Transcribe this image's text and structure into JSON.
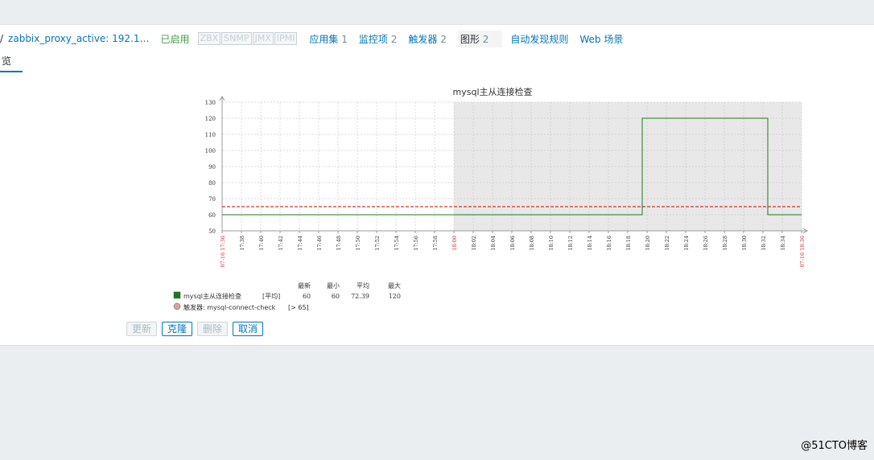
{
  "nav": {
    "sep": "/",
    "host": "zabbix_proxy_active: 192.1…",
    "status": "已启用",
    "availability": [
      "ZBX",
      "SNMP",
      "JMX",
      "IPMI"
    ],
    "links": [
      {
        "label": "应用集",
        "count": "1"
      },
      {
        "label": "监控项",
        "count": "2"
      },
      {
        "label": "触发器",
        "count": "2"
      },
      {
        "label": "图形",
        "count": "2",
        "current": true
      },
      {
        "label": "自动发现规则",
        "count": ""
      },
      {
        "label": "Web 场景",
        "count": ""
      }
    ]
  },
  "tab": {
    "label": "览"
  },
  "chart_data": {
    "type": "line",
    "title": "mysql主从连接检查",
    "ylim": [
      50,
      130
    ],
    "y_ticks": [
      50,
      60,
      70,
      80,
      90,
      100,
      110,
      120,
      130
    ],
    "x_labels": [
      "07-16 17:36",
      "17:38",
      "17:40",
      "17:42",
      "17:44",
      "17:46",
      "17:48",
      "17:50",
      "17:52",
      "17:54",
      "17:56",
      "17:58",
      "18:00",
      "18:02",
      "18:04",
      "18:06",
      "18:08",
      "18:10",
      "18:12",
      "18:14",
      "18:16",
      "18:18",
      "18:20",
      "18:22",
      "18:24",
      "18:26",
      "18:28",
      "18:30",
      "18:32",
      "18:34",
      "07-16 18:36"
    ],
    "x_red_labels": [
      "07-16 17:36",
      "18:00",
      "07-16 18:36"
    ],
    "shade_from_minute": 24,
    "series": [
      {
        "name": "mysql主从连接检查",
        "color": "#1a7c1a",
        "points": [
          [
            0,
            60
          ],
          [
            43.5,
            60
          ],
          [
            43.5,
            120
          ],
          [
            56.5,
            120
          ],
          [
            56.5,
            60
          ],
          [
            60,
            60
          ]
        ]
      }
    ],
    "trigger": {
      "value": 65,
      "color": "#cc0000"
    },
    "legend": {
      "headers": [
        "最新",
        "最小",
        "平均",
        "最大"
      ],
      "rows": [
        {
          "color": "#1a7c1a",
          "name": "mysql主从连接检查",
          "func": "[平均]",
          "values": [
            "60",
            "60",
            "72.39",
            "120"
          ]
        }
      ],
      "trigger": {
        "color": "#e0a0a0",
        "name": "触发器: mysql-connect-check",
        "cond": "[> 65]"
      }
    }
  },
  "buttons": {
    "update": "更新",
    "clone": "克隆",
    "delete": "删除",
    "cancel": "取消"
  },
  "watermark": "@51CTO博客"
}
